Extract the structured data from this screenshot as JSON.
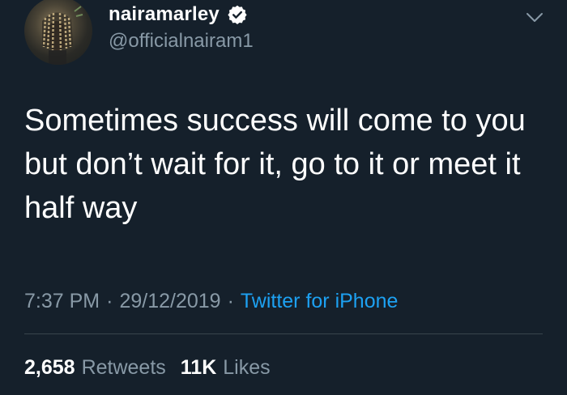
{
  "user": {
    "display_name": "nairamarley",
    "handle": "@officialnairam1",
    "verified": true
  },
  "tweet": {
    "text_lines": [
      "Sometimes success will come to you",
      "but don’t wait for it, go to it or meet it",
      "half way"
    ],
    "time": "7:37 PM",
    "date": "29/12/2019",
    "separator": "·",
    "source": "Twitter for iPhone"
  },
  "stats": {
    "retweets_count": "2,658",
    "retweets_label": "Retweets",
    "likes_count": "11K",
    "likes_label": "Likes"
  },
  "icons": {
    "verified": "verified-badge-icon",
    "menu": "chevron-down-icon"
  },
  "colors": {
    "background": "#15202b",
    "secondary_text": "#8899a6",
    "link": "#1da1f2",
    "divider": "#38444d"
  }
}
